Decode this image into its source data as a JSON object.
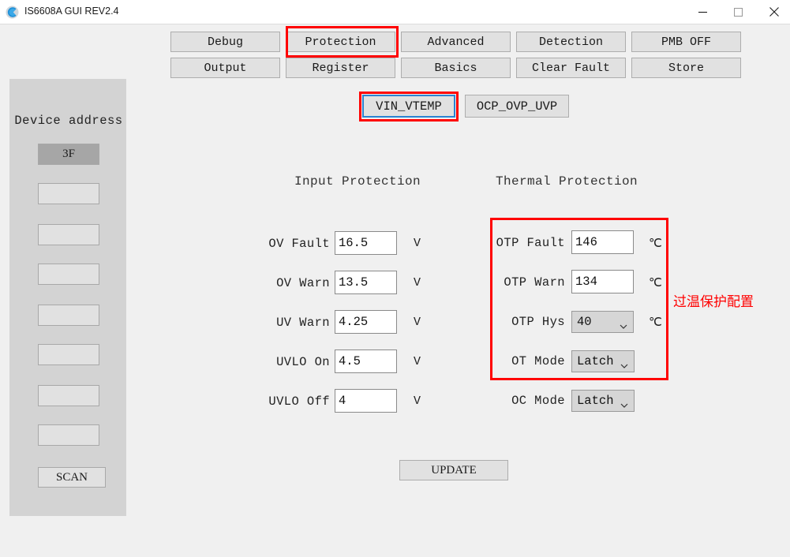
{
  "window": {
    "title": "IS6608A GUI REV2.4",
    "icon": "app-logo-icon",
    "controls": {
      "minimize": "minimize-icon",
      "maximize": "maximize-icon",
      "close": "close-icon"
    }
  },
  "sidebar": {
    "heading": "Device address",
    "address_buttons": [
      {
        "label": "3F",
        "selected": true
      },
      {
        "label": "",
        "selected": false
      },
      {
        "label": "",
        "selected": false
      },
      {
        "label": "",
        "selected": false
      },
      {
        "label": "",
        "selected": false
      },
      {
        "label": "",
        "selected": false
      },
      {
        "label": "",
        "selected": false
      },
      {
        "label": "",
        "selected": false
      }
    ],
    "scan_label": "SCAN"
  },
  "nav": {
    "row1": [
      {
        "label": "Debug",
        "active": false
      },
      {
        "label": "Protection",
        "active": true
      },
      {
        "label": "Advanced",
        "active": false
      },
      {
        "label": "Detection",
        "active": false
      },
      {
        "label": "PMB OFF",
        "active": false
      }
    ],
    "row2": [
      {
        "label": "Output",
        "active": false
      },
      {
        "label": "Register",
        "active": false
      },
      {
        "label": "Basics",
        "active": false
      },
      {
        "label": "Clear Fault",
        "active": false
      },
      {
        "label": "Store",
        "active": false
      }
    ]
  },
  "subtabs": [
    {
      "label": "VIN_VTEMP",
      "active": true
    },
    {
      "label": "OCP_OVP_UVP",
      "active": false
    }
  ],
  "input_protection": {
    "heading": "Input Protection",
    "rows": [
      {
        "label": "OV Fault",
        "value": "16.5",
        "unit": "V"
      },
      {
        "label": "OV Warn",
        "value": "13.5",
        "unit": "V"
      },
      {
        "label": "UV Warn",
        "value": "4.25",
        "unit": "V"
      },
      {
        "label": "UVLO On",
        "value": "4.5",
        "unit": "V"
      },
      {
        "label": "UVLO Off",
        "value": "4",
        "unit": "V"
      }
    ]
  },
  "thermal_protection": {
    "heading": "Thermal Protection",
    "rows": [
      {
        "label": "OTP Fault",
        "value": "146",
        "unit": "℃",
        "type": "text"
      },
      {
        "label": "OTP Warn",
        "value": "134",
        "unit": "℃",
        "type": "text"
      },
      {
        "label": "OTP Hys",
        "value": "40",
        "unit": "℃",
        "type": "select"
      },
      {
        "label": "OT Mode",
        "value": "Latch",
        "unit": "",
        "type": "select"
      },
      {
        "label": "OC Mode",
        "value": "Latch",
        "unit": "",
        "type": "select"
      }
    ]
  },
  "update_label": "UPDATE",
  "annotations": {
    "text": "过温保护配置",
    "color": "#ff0000"
  }
}
